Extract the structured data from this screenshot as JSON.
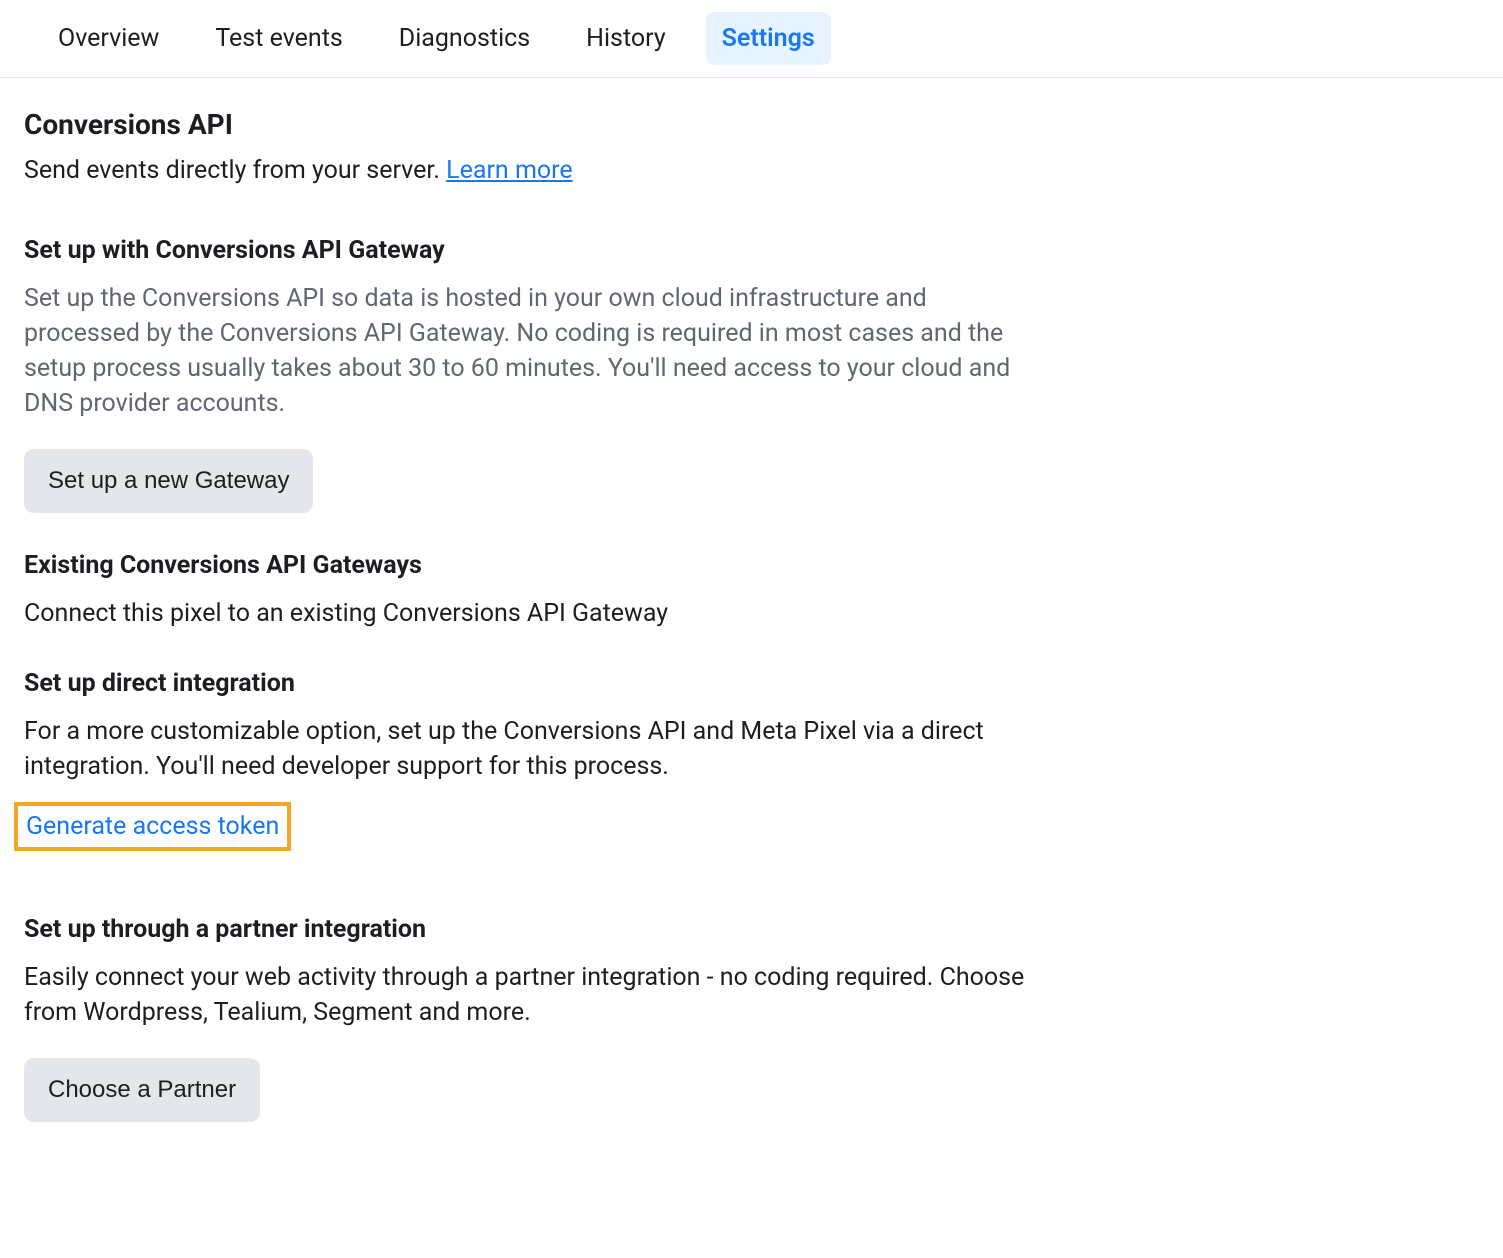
{
  "tabs": {
    "overview": "Overview",
    "test_events": "Test events",
    "diagnostics": "Diagnostics",
    "history": "History",
    "settings": "Settings"
  },
  "header": {
    "title": "Conversions API",
    "subtitle_prefix": "Send events directly from your server. ",
    "learn_more": "Learn more"
  },
  "sections": {
    "gateway_setup": {
      "heading": "Set up with Conversions API Gateway",
      "body": "Set up the Conversions API so data is hosted in your own cloud infrastructure and processed by the Conversions API Gateway. No coding is required in most cases and the setup process usually takes about 30 to 60 minutes. You'll need access to your cloud and DNS provider accounts.",
      "button": "Set up a new Gateway"
    },
    "existing_gateways": {
      "heading": "Existing Conversions API Gateways",
      "body": "Connect this pixel to an existing Conversions API Gateway"
    },
    "direct_integration": {
      "heading": "Set up direct integration",
      "body": "For a more customizable option, set up the Conversions API and Meta Pixel via a direct integration. You'll need developer support for this process.",
      "link": "Generate access token"
    },
    "partner_integration": {
      "heading": "Set up through a partner integration",
      "body": "Easily connect your web activity through a partner integration - no coding required. Choose from Wordpress, Tealium, Segment and more.",
      "button": "Choose a Partner"
    }
  }
}
